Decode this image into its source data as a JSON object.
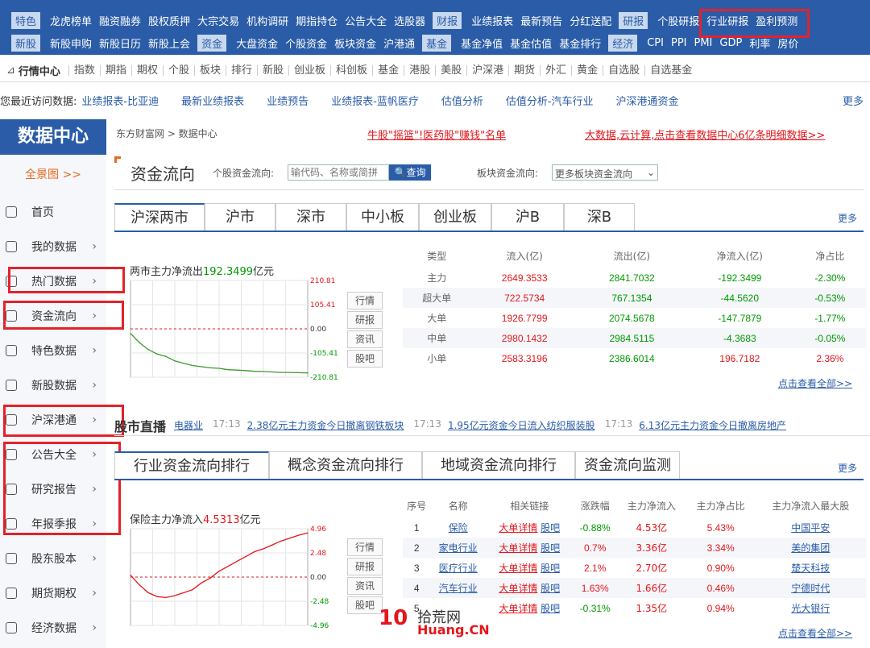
{
  "topnav": {
    "row1": [
      "特色",
      "龙虎榜单",
      "融资融券",
      "股权质押",
      "大宗交易",
      "机构调研",
      "期指持仓",
      "公告大全",
      "选股器",
      "财报",
      "业绩报表",
      "最新预告",
      "分红送配",
      "研报",
      "个股研报",
      "行业研报",
      "盈利预测"
    ],
    "row2": [
      "新股",
      "新股申购",
      "新股日历",
      "新股上会",
      "资金",
      "大盘资金",
      "个股资金",
      "板块资金",
      "沪港通",
      "基金",
      "基金净值",
      "基金估值",
      "基金排行",
      "经济",
      "CPI",
      "PPI",
      "PMI",
      "GDP",
      "利率",
      "房价"
    ]
  },
  "quickbar": {
    "title": "行情中心",
    "items": [
      "指数",
      "期指",
      "期权",
      "个股",
      "板块",
      "排行",
      "新股",
      "创业板",
      "科创板",
      "基金",
      "港股",
      "美股",
      "沪深港",
      "期货",
      "外汇",
      "黄金",
      "自选股",
      "自选基金"
    ]
  },
  "recent": {
    "label": "您最近访问数据:",
    "items": [
      "业绩报表-比亚迪",
      "最新业绩报表",
      "业绩预告",
      "业绩报表-蓝帆医疗",
      "估值分析",
      "估值分析-汽车行业",
      "沪深港通资金"
    ],
    "more": "更多"
  },
  "sidebar": {
    "brand": "数据中心",
    "fullmap": "全景图 >>",
    "items": [
      "首页",
      "我的数据",
      "热门数据",
      "资金流向",
      "特色数据",
      "新股数据",
      "沪深港通",
      "公告大全",
      "研究报告",
      "年报季报",
      "股东股本",
      "期货期权",
      "经济数据"
    ]
  },
  "crumbs": "东方财富网 > 数据中心",
  "promo1": "牛股\"摇篮\"!医药股\"赚钱\"名单",
  "promo2": "大数据,云计算,点击查看数据中心6亿条明细数据>>",
  "money": {
    "title": "资金流向",
    "stock_label": "个股资金流向:",
    "stock_placeholder": "输代码、名称或简拼",
    "query": "查询",
    "block_label": "板块资金流向:",
    "block_value": "更多板块资金流向"
  },
  "market_tabs": [
    "沪深两市",
    "沪市",
    "深市",
    "中小板",
    "创业板",
    "沪B",
    "深B"
  ],
  "more": "更多",
  "chart1": {
    "title_prefix": "两市主力净流出",
    "value": "192.3499",
    "unit": "亿元",
    "ticks": [
      "210.81",
      "105.41",
      "0.00",
      "-105.41",
      "-210.81"
    ]
  },
  "side_btns": [
    "行情",
    "研报",
    "资讯",
    "股吧"
  ],
  "flow": {
    "headers": [
      "类型",
      "流入(亿)",
      "流出(亿)",
      "净流入(亿)",
      "净占比"
    ],
    "rows": [
      [
        "主力",
        "2649.3533",
        "2841.7032",
        "-192.3499",
        "-2.30%"
      ],
      [
        "超大单",
        "722.5734",
        "767.1354",
        "-44.5620",
        "-0.53%"
      ],
      [
        "大单",
        "1926.7799",
        "2074.5678",
        "-147.7879",
        "-1.77%"
      ],
      [
        "中单",
        "2980.1432",
        "2984.5115",
        "-4.3683",
        "-0.05%"
      ],
      [
        "小单",
        "2583.3196",
        "2386.6014",
        "196.7182",
        "2.36%"
      ]
    ],
    "view_all": "点击查看全部>>"
  },
  "ticker": {
    "label": "股市直播",
    "items": [
      {
        "text": "电器业",
        "time": "17:13"
      },
      {
        "text": "2.38亿元主力资金今日撤离钢铁板块",
        "time": "17:13"
      },
      {
        "text": "1.95亿元资金今日流入纺织服装股",
        "time": "17:13"
      },
      {
        "text": "6.13亿元主力资金今日撤离房地产",
        "time": ""
      }
    ]
  },
  "industry_tabs": [
    "行业资金流向排行",
    "概念资金流向排行",
    "地域资金流向排行",
    "资金流向监测"
  ],
  "chart2": {
    "title_prefix": "保险主力净流入",
    "value": "4.5313",
    "unit": "亿元",
    "ticks": [
      "4.96",
      "2.48",
      "0.00",
      "-2.48",
      "-4.96"
    ]
  },
  "industry": {
    "headers": [
      "序号",
      "名称",
      "相关链接",
      "涨跌幅",
      "主力净流入",
      "主力净占比",
      "主力净流入最大股"
    ],
    "rows": [
      [
        "1",
        "保险",
        "大单详情",
        "股吧",
        "-0.88%",
        "4.53亿",
        "5.43%",
        "中国平安"
      ],
      [
        "2",
        "家电行业",
        "大单详情",
        "股吧",
        "0.7%",
        "3.36亿",
        "3.34%",
        "美的集团"
      ],
      [
        "3",
        "医疗行业",
        "大单详情",
        "股吧",
        "2.1%",
        "2.70亿",
        "0.90%",
        "楚天科技"
      ],
      [
        "4",
        "汽车行业",
        "大单详情",
        "股吧",
        "1.63%",
        "1.66亿",
        "0.46%",
        "宁德时代"
      ],
      [
        "5",
        "",
        "大单详情",
        "股吧",
        "-0.31%",
        "1.35亿",
        "0.94%",
        "光大银行"
      ]
    ],
    "view_all": "点击查看全部>>"
  },
  "chart_data": [
    {
      "type": "line",
      "title": "两市主力净流出192.3499亿元",
      "ylim": [
        -210.81,
        210.81
      ],
      "ticks": [
        210.81,
        105.41,
        0,
        -105.41,
        -210.81
      ],
      "series": [
        {
          "values": [
            -20,
            -60,
            -90,
            -110,
            -120,
            -140,
            -150,
            -160,
            -165,
            -170,
            -172,
            -178,
            -180,
            -182,
            -185,
            -186,
            -188,
            -190,
            -190,
            -191,
            -192.35
          ]
        }
      ]
    },
    {
      "type": "line",
      "title": "保险主力净流入4.5313亿元",
      "ylim": [
        -4.96,
        4.96
      ],
      "ticks": [
        4.96,
        2.48,
        0,
        -2.48,
        -4.96
      ],
      "series": [
        {
          "values": [
            0.2,
            -0.8,
            -1.6,
            -2.0,
            -2.1,
            -1.9,
            -1.6,
            -1.3,
            -0.6,
            -0.1,
            0.6,
            1.1,
            1.6,
            2.1,
            2.6,
            2.9,
            3.3,
            3.7,
            4.0,
            4.3,
            4.53
          ]
        }
      ]
    }
  ],
  "watermark": {
    "logo": "10",
    "name": "拾荒网",
    "url": "Huang.CN"
  }
}
